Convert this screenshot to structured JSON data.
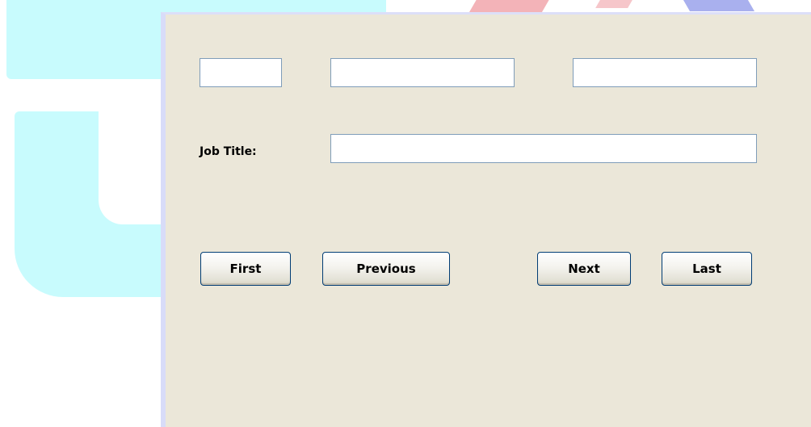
{
  "form": {
    "first_name": {
      "value": "",
      "placeholder": ""
    },
    "middle_name": {
      "value": "",
      "placeholder": ""
    },
    "last_name": {
      "value": "",
      "placeholder": ""
    },
    "job_title_label": "Job Title:",
    "job_title": {
      "value": "",
      "placeholder": ""
    }
  },
  "navigation": {
    "first_label": "First",
    "previous_label": "Previous",
    "next_label": "Next",
    "last_label": "Last"
  },
  "colors": {
    "window_background": "#ebe7d9",
    "field_border": "#7f9db9",
    "button_border": "#003c74",
    "background_cyan": "#c8fbfd"
  }
}
